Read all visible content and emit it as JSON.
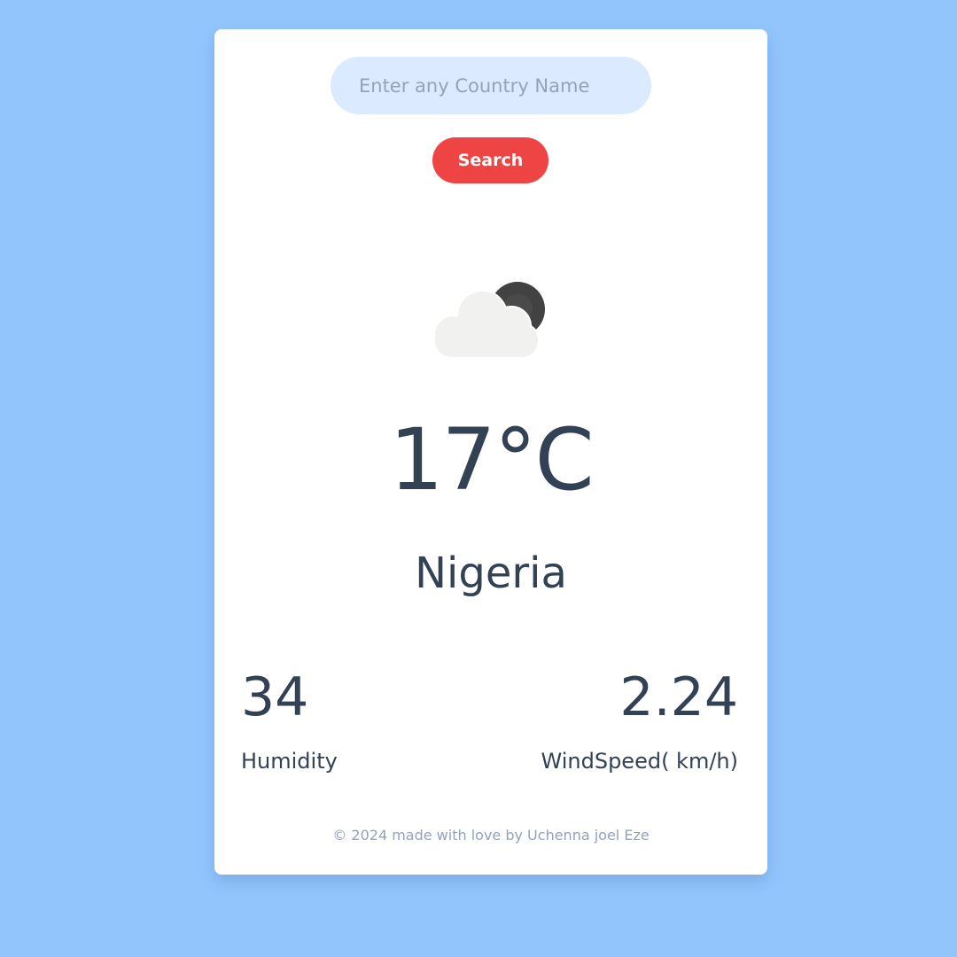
{
  "background_color": "#93c5fd",
  "search": {
    "placeholder": "Enter any Country Name",
    "value": "",
    "button_label": "Search",
    "button_color": "#ef4444"
  },
  "weather": {
    "icon": "cloud-moon-icon",
    "temperature": "17°C",
    "location": "Nigeria"
  },
  "stats": {
    "humidity_value": "34",
    "humidity_label": "Humidity",
    "windspeed_value": "2.24",
    "windspeed_label": "WindSpeed( km/h)"
  },
  "footer": {
    "text": "© 2024 made with love by Uchenna joel Eze"
  }
}
